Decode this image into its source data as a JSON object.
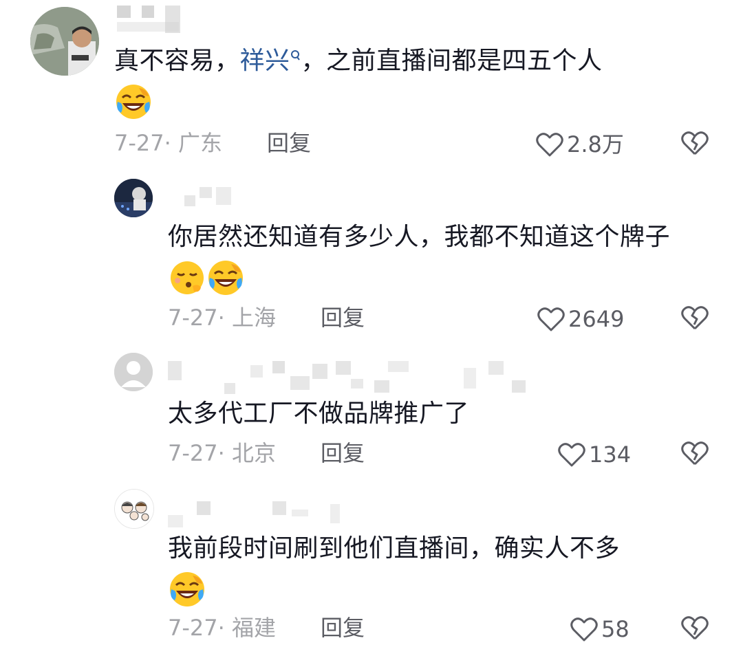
{
  "colors": {
    "text": "#161823",
    "meta": "#a3a4a8",
    "action": "#5b5c63",
    "mention": "#2e5b9a"
  },
  "comments": [
    {
      "avatar_icon": "user-photo-avatar",
      "text_before": "真不容易，",
      "mention": "祥兴",
      "text_after": "，之前直播间都是四五个人",
      "emojis": [
        "laugh-cry-emoji"
      ],
      "date_location": "7-27· 广东",
      "reply_label": "回复",
      "like_count": "2.8万"
    },
    {
      "avatar_icon": "user-photo-avatar",
      "text": "你居然还知道有多少人，我都不知道这个牌子",
      "emojis": [
        "thinking-cold-emoji",
        "laugh-cry-emoji"
      ],
      "date_location": "7-27· 上海",
      "reply_label": "回复",
      "like_count": "2649"
    },
    {
      "avatar_icon": "default-user-avatar",
      "text": "太多代工厂不做品牌推广了",
      "date_location": "7-27· 北京",
      "reply_label": "回复",
      "like_count": "134"
    },
    {
      "avatar_icon": "cartoon-family-avatar",
      "text": "我前段时间刷到他们直播间，确实人不多",
      "emojis": [
        "laugh-cry-emoji"
      ],
      "date_location": "7-27· 福建",
      "reply_label": "回复",
      "like_count": "58"
    }
  ]
}
